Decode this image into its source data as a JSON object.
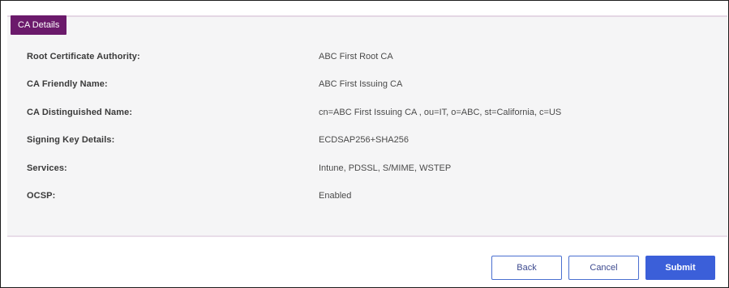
{
  "section": {
    "title": "CA Details"
  },
  "details": [
    {
      "label": "Root Certificate Authority:",
      "value": "ABC First Root CA"
    },
    {
      "label": "CA Friendly Name:",
      "value": "ABC First Issuing CA"
    },
    {
      "label": "CA Distinguished Name:",
      "value": "cn=ABC First Issuing CA , ou=IT, o=ABC, st=California, c=US"
    },
    {
      "label": "Signing Key Details:",
      "value": "ECDSAP256+SHA256"
    },
    {
      "label": "Services:",
      "value": "Intune, PDSSL, S/MIME, WSTEP"
    },
    {
      "label": "OCSP:",
      "value": "Enabled"
    }
  ],
  "actions": {
    "back_label": "Back",
    "cancel_label": "Cancel",
    "submit_label": "Submit"
  },
  "colors": {
    "accent": "#6b1a6b",
    "primary_button": "#3b5fd9",
    "panel_background": "#f5f5f6"
  }
}
